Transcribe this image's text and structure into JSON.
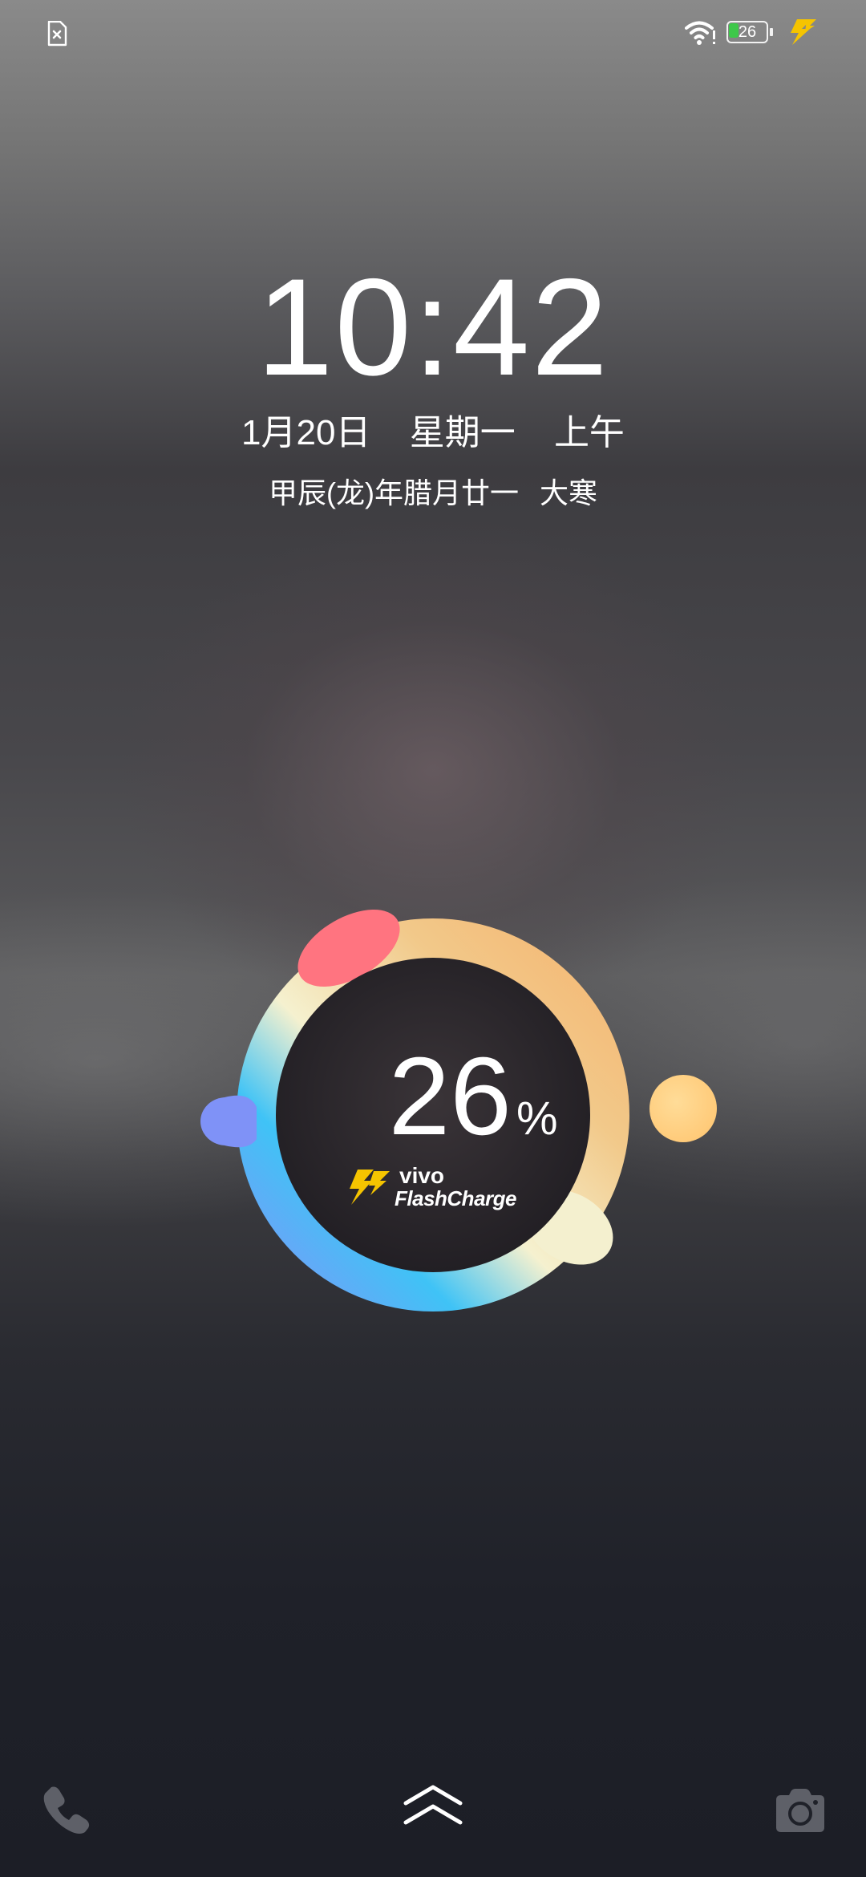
{
  "status_bar": {
    "battery_level": "26",
    "battery_fraction": 0.26,
    "icons": [
      "sim-card-missing-icon",
      "wifi-icon",
      "battery-icon",
      "charging-bolt-icon"
    ],
    "battery_fill_color": "#3ec84a",
    "bolt_color": "#f5c400"
  },
  "lockscreen": {
    "time": "10:42",
    "date": "1月20日",
    "weekday": "星期一",
    "period": "上午",
    "lunar_date": "甲辰(龙)年腊月廿一",
    "solar_term": "大寒"
  },
  "charging": {
    "percent": "26",
    "percent_sign": "%",
    "brand": "vivo",
    "technology": "FlashCharge",
    "ring_colors": [
      "#ff6f7a",
      "#f2b36a",
      "#f6f2cc",
      "#45c6f5",
      "#8a8df7"
    ],
    "orb_color": "#ffcb7a"
  },
  "bottom_bar": {
    "icons": [
      "phone-icon",
      "swipe-up-arrows-icon",
      "camera-icon"
    ]
  }
}
